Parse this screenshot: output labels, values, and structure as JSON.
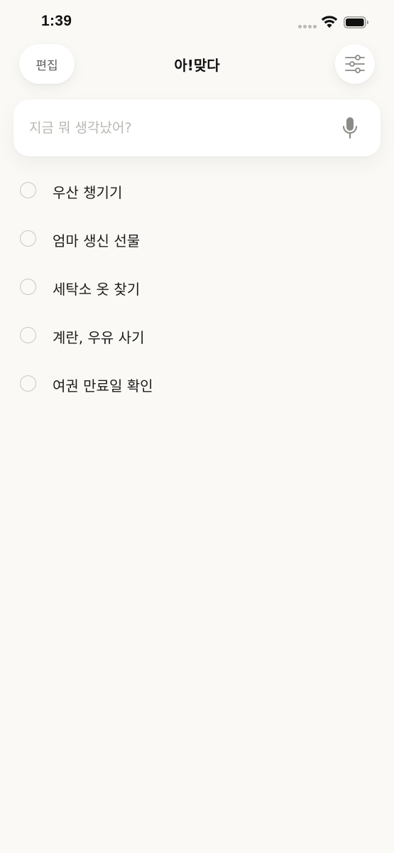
{
  "status_bar": {
    "time": "1:39",
    "wifi_icon": "wifi-icon",
    "battery_icon": "battery-icon"
  },
  "header": {
    "edit_label": "편집",
    "title": "아!맞다",
    "filter_icon": "sliders-icon"
  },
  "input": {
    "placeholder": "지금 뭐 생각났어?",
    "value": "",
    "mic_icon": "microphone-icon"
  },
  "todos": [
    {
      "text": "우산 챙기기",
      "checked": false
    },
    {
      "text": "엄마 생신 선물",
      "checked": false
    },
    {
      "text": "세탁소 옷 찾기",
      "checked": false
    },
    {
      "text": "계란, 우유 사기",
      "checked": false
    },
    {
      "text": "여권 만료일 확인",
      "checked": false
    }
  ],
  "colors": {
    "background": "#FAF9F5",
    "card": "#FFFFFF",
    "placeholder": "#B9B7B2",
    "checkbox_border": "#C9C7C2",
    "icon_gray": "#8C8A86"
  }
}
